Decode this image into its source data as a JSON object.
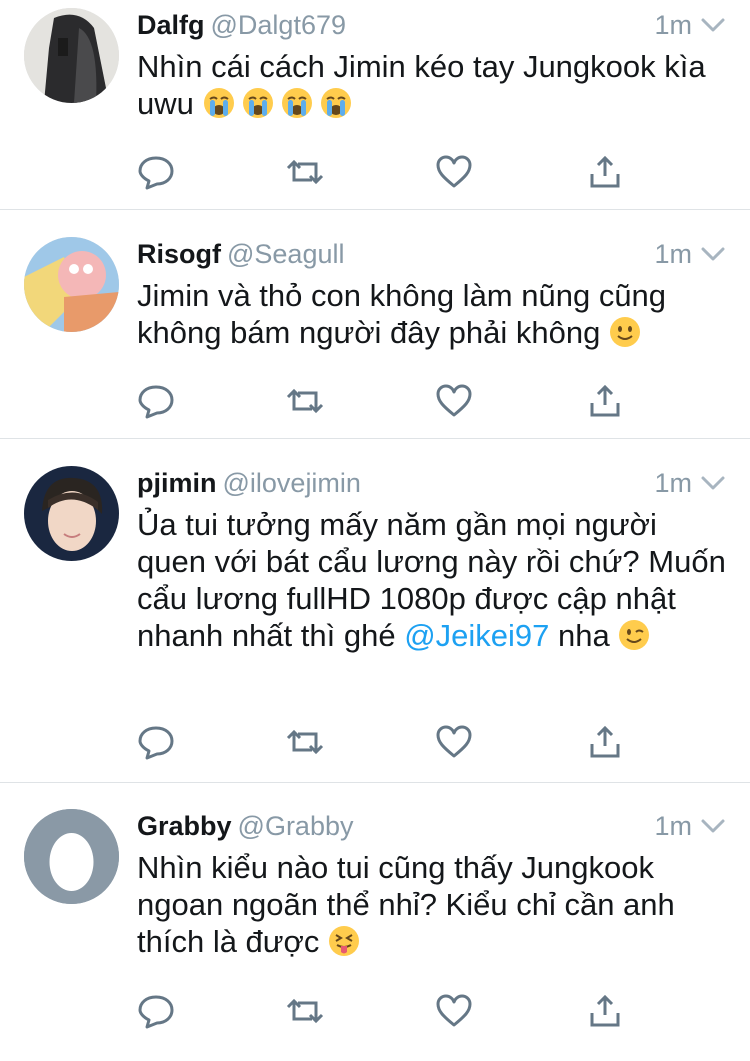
{
  "tweets": [
    {
      "name": "Dalfg",
      "handle": "@Dalgt679",
      "time": "1m",
      "text": "Nhìn cái cách Jimin kéo tay Jungkook kìa uwu",
      "emojis": [
        "loudly-crying-face",
        "loudly-crying-face",
        "loudly-crying-face",
        "loudly-crying-face"
      ]
    },
    {
      "name": "Risogf",
      "handle": "@Seagull",
      "time": "1m",
      "text": "Jimin và thỏ con không làm nũng cũng không bám người đây phải không",
      "emojis": [
        "slightly-smiling-face"
      ]
    },
    {
      "name": "pjimin",
      "handle": "@ilovejimin",
      "time": "1m",
      "text_before": "Ủa tui tưởng mấy năm gần mọi người quen với bát cẩu lương này rồi chứ? Muốn cẩu lương fullHD 1080p được cập nhật nhanh nhất thì ghé ",
      "mention": "@Jeikei97",
      "text_after": " nha",
      "emojis": [
        "winking-face"
      ]
    },
    {
      "name": "Grabby",
      "handle": "@Grabby",
      "time": "1m",
      "text": "Nhìn kiểu nào tui cũng thấy Jungkook ngoan ngoãn thể nhỉ? Kiểu chỉ cần anh thích là được",
      "emojis": [
        "squinting-face-with-tongue"
      ]
    }
  ],
  "icons": {
    "reply": "reply-icon",
    "retweet": "retweet-icon",
    "like": "heart-icon",
    "share": "share-icon",
    "more": "chevron-down-icon"
  },
  "colors": {
    "text": "#14171a",
    "secondary": "#8899a6",
    "link": "#1da1f2",
    "divider": "#dfe3e6"
  }
}
